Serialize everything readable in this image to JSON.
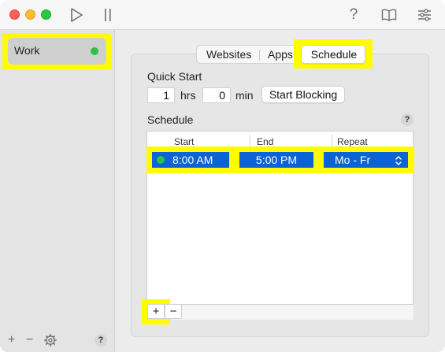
{
  "toolbar": {
    "play_icon": "play-icon",
    "pause_icon": "pause-icon",
    "help_label": "?",
    "book_icon": "book-icon",
    "sliders_icon": "sliders-icon"
  },
  "sidebar": {
    "profiles": [
      {
        "label": "Work",
        "status_color": "#2fbf4a"
      }
    ],
    "footer": {
      "add_label": "+",
      "remove_label": "−",
      "help_label": "?"
    }
  },
  "tabs": [
    {
      "label": "Websites",
      "selected": false
    },
    {
      "label": "Apps",
      "selected": false
    },
    {
      "label": "Schedule",
      "selected": true
    }
  ],
  "quick_start": {
    "title": "Quick Start",
    "hours_value": "1",
    "hours_unit": "hrs",
    "minutes_value": "0",
    "minutes_unit": "min",
    "start_button": "Start Blocking"
  },
  "schedule": {
    "title": "Schedule",
    "help_label": "?",
    "columns": [
      "Start",
      "End",
      "Repeat"
    ],
    "rows": [
      {
        "start": "8:00 AM",
        "end": "5:00 PM",
        "repeat": "Mo - Fr",
        "status_color": "#2fbf4a"
      }
    ],
    "add_label": "+",
    "remove_label": "−"
  },
  "colors": {
    "highlight": "#fffb00",
    "selection": "#0b63d6",
    "active_dot": "#2fbf4a"
  }
}
